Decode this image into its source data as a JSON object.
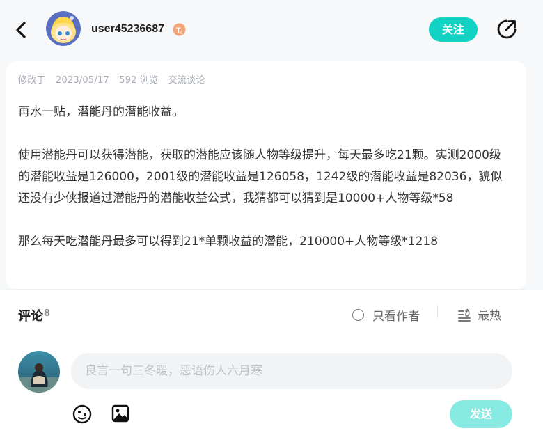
{
  "header": {
    "username": "user45236687",
    "follow_label": "关注"
  },
  "post": {
    "meta": {
      "modified": "修改于",
      "date": "2023/05/17",
      "views": "592 浏览",
      "category": "交流谈论"
    },
    "paragraphs": [
      "再水一贴，潜能丹的潜能收益。",
      "使用潜能丹可以获得潜能，获取的潜能应该随人物等级提升，每天最多吃21颗。实测2000级的潜能收益是126000，2001级的潜能收益是126058，1242级的潜能收益是82036，貌似还没有少侠报道过潜能丹的潜能收益公式，我猜都可以猜到是10000+人物等级*58",
      "那么每天吃潜能丹最多可以得到21*单颗收益的潜能，210000+人物等级*1218"
    ]
  },
  "comments": {
    "title": "评论",
    "count": "8",
    "author_only": "只看作者",
    "sort_hot": "最热",
    "input_placeholder": "良言一句三冬暖，恶语伤人六月寒",
    "send_label": "发送"
  },
  "colors": {
    "accent": "#11d2c3",
    "accent_light": "#87ebe3"
  }
}
